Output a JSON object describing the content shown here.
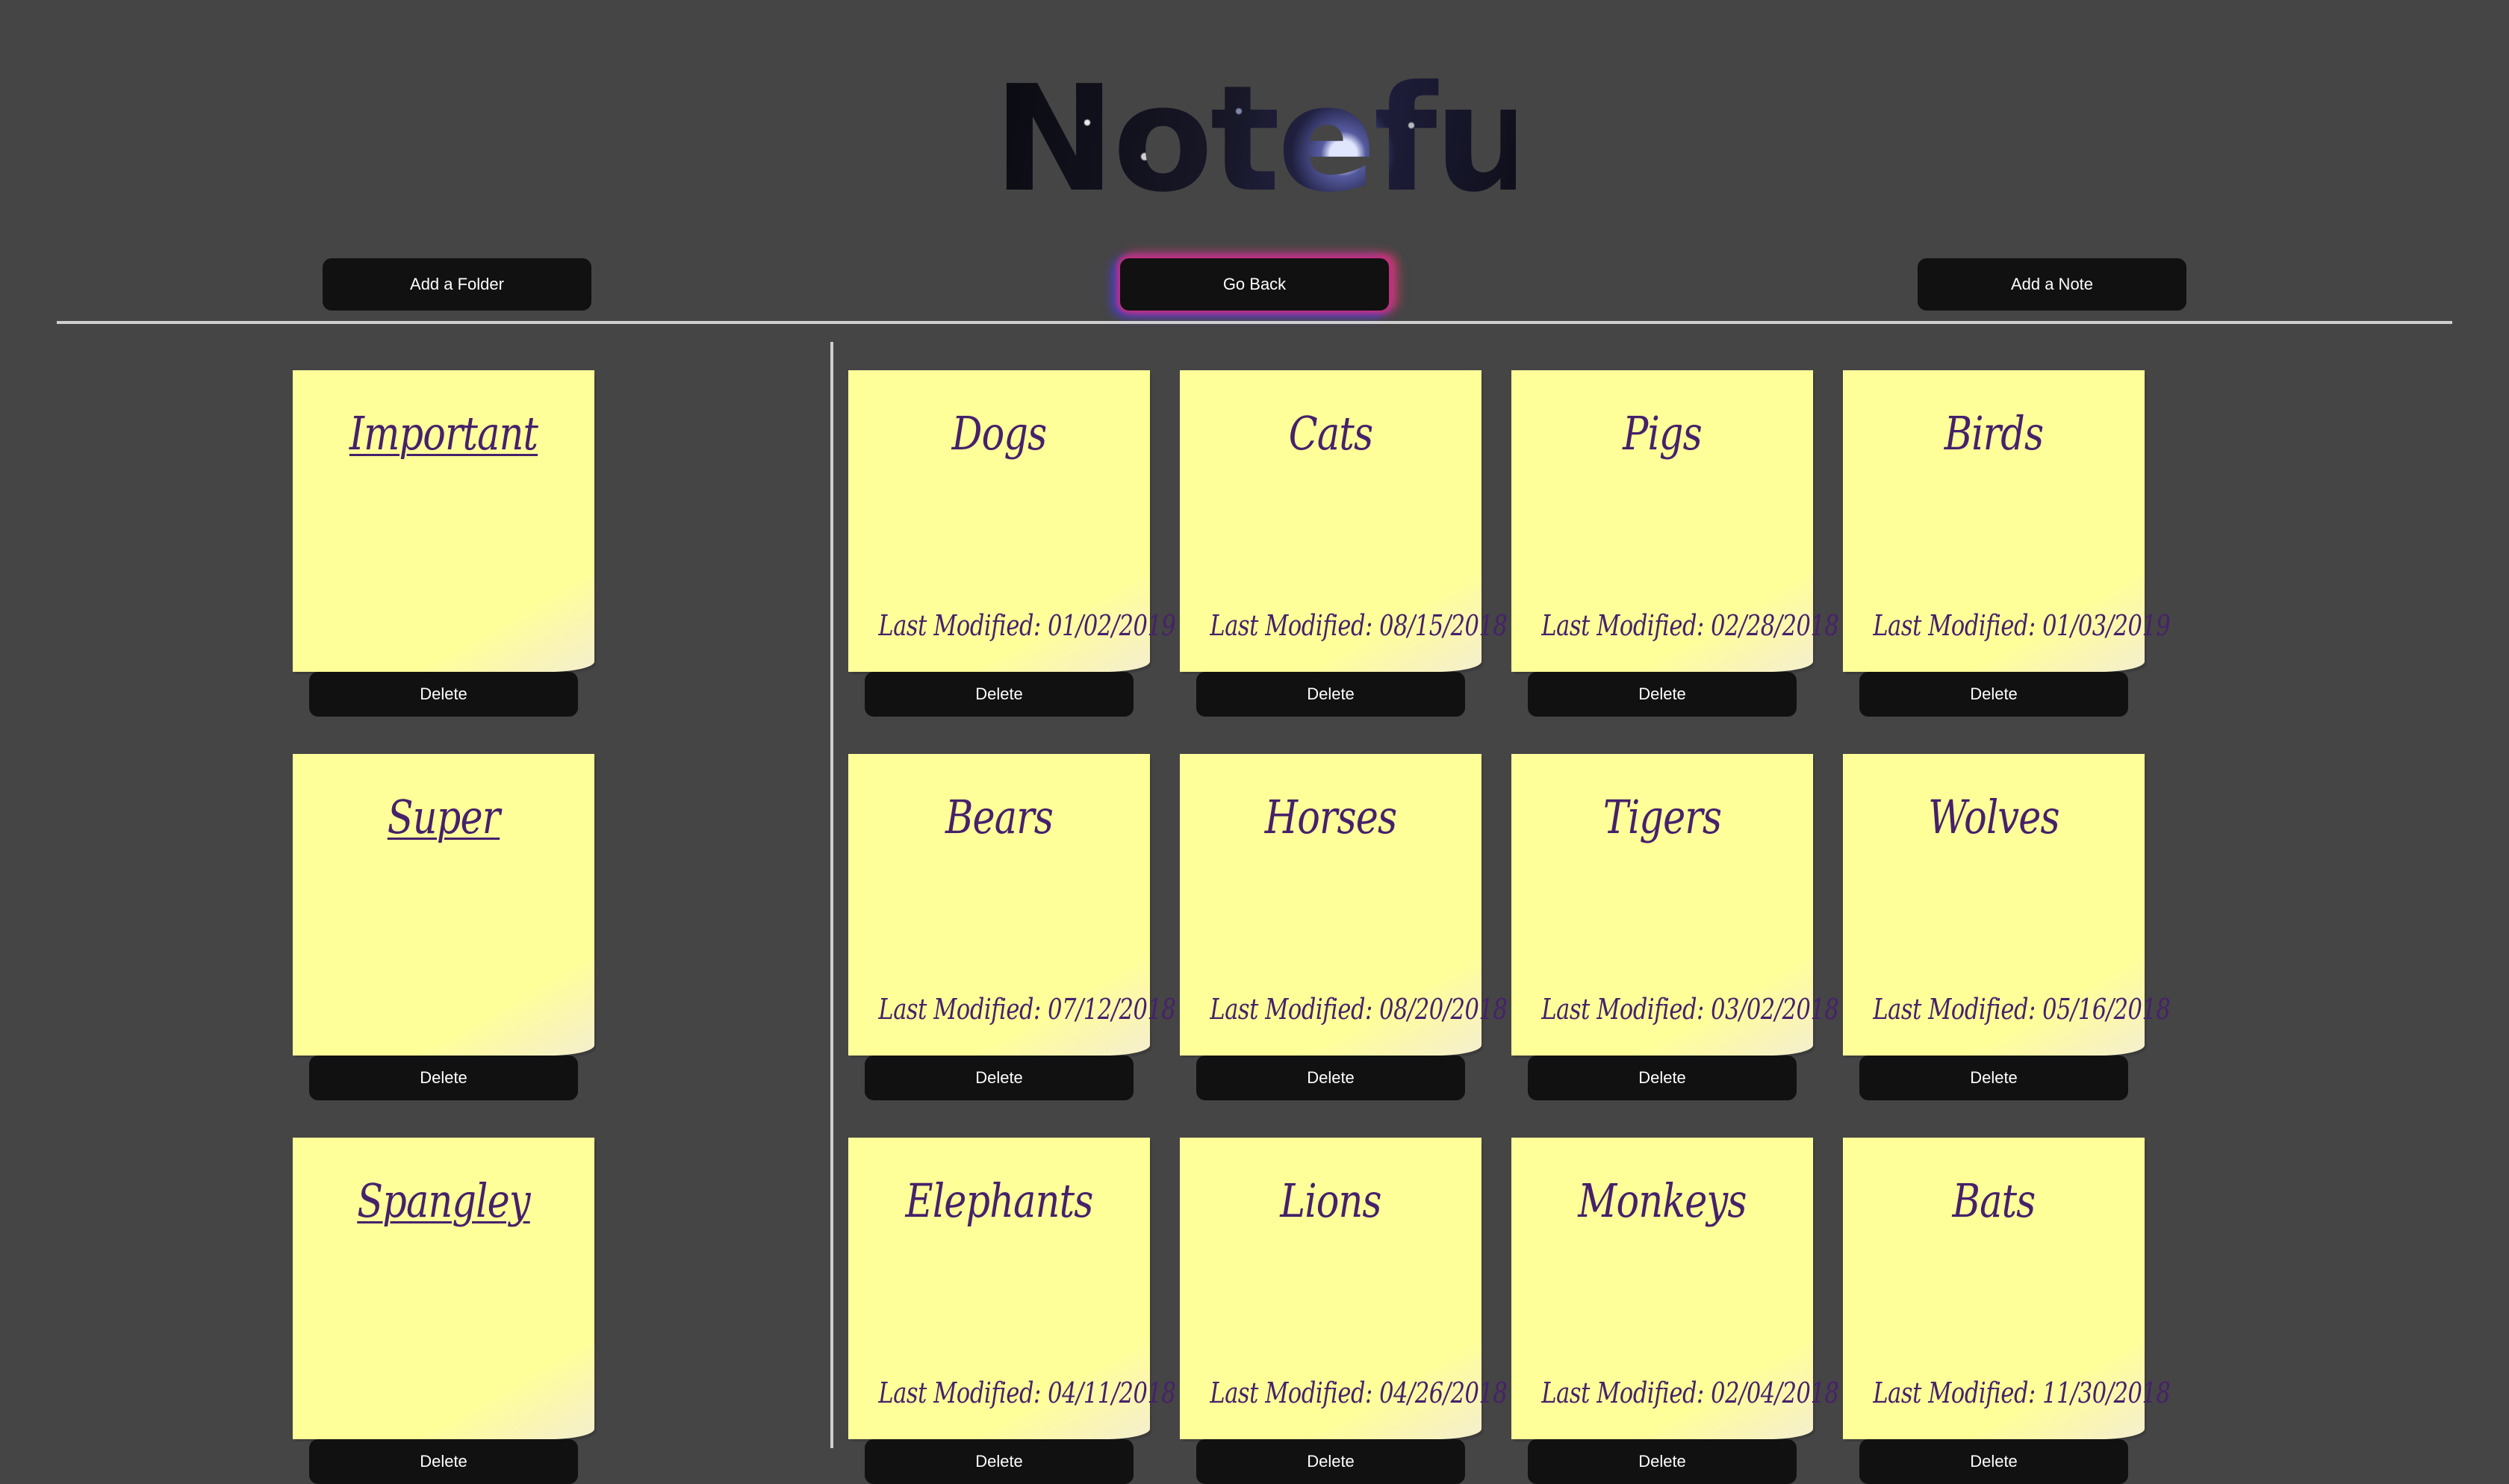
{
  "app_title": "Noteful",
  "header": {
    "add_folder_label": "Add a Folder",
    "go_back_label": "Go Back",
    "add_note_label": "Add a Note"
  },
  "folders": [
    {
      "name": "Important",
      "delete_label": "Delete"
    },
    {
      "name": "Super",
      "delete_label": "Delete"
    },
    {
      "name": "Spangley",
      "delete_label": "Delete"
    }
  ],
  "notes": [
    {
      "name": "Dogs",
      "modified": "Last Modified: 01/02/2019",
      "delete_label": "Delete"
    },
    {
      "name": "Cats",
      "modified": "Last Modified: 08/15/2018",
      "delete_label": "Delete"
    },
    {
      "name": "Pigs",
      "modified": "Last Modified: 02/28/2018",
      "delete_label": "Delete"
    },
    {
      "name": "Birds",
      "modified": "Last Modified: 01/03/2019",
      "delete_label": "Delete"
    },
    {
      "name": "Bears",
      "modified": "Last Modified: 07/12/2018",
      "delete_label": "Delete"
    },
    {
      "name": "Horses",
      "modified": "Last Modified: 08/20/2018",
      "delete_label": "Delete"
    },
    {
      "name": "Tigers",
      "modified": "Last Modified: 03/02/2018",
      "delete_label": "Delete"
    },
    {
      "name": "Wolves",
      "modified": "Last Modified: 05/16/2018",
      "delete_label": "Delete"
    },
    {
      "name": "Elephants",
      "modified": "Last Modified: 04/11/2018",
      "delete_label": "Delete"
    },
    {
      "name": "Lions",
      "modified": "Last Modified: 04/26/2018",
      "delete_label": "Delete"
    },
    {
      "name": "Monkeys",
      "modified": "Last Modified: 02/04/2018",
      "delete_label": "Delete"
    },
    {
      "name": "Bats",
      "modified": "Last Modified: 11/30/2018",
      "delete_label": "Delete"
    }
  ],
  "colors": {
    "background": "#454545",
    "sticky_note": "#ffff99",
    "note_text": "#46216b",
    "button": "#111111",
    "button_text": "#ffffff",
    "go_back_glow": "#c2307a"
  }
}
